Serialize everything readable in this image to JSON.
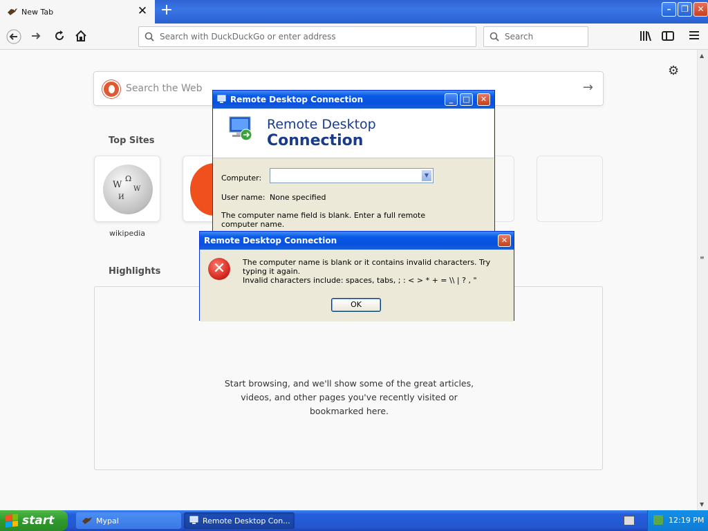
{
  "browser": {
    "tab": {
      "title": "New Tab",
      "icon": "bird-favicon-icon"
    },
    "toolbar": {
      "url_placeholder": "Search with DuckDuckGo or enter address",
      "search_placeholder": "Search"
    }
  },
  "page": {
    "web_search_placeholder": "Search the Web",
    "top_sites_title": "Top Sites",
    "top_sites": [
      {
        "label": "wikipedia",
        "icon": "wikipedia-globe-icon"
      },
      {
        "label": "",
        "icon": "brave-lion-icon"
      }
    ],
    "highlights_title": "Highlights",
    "highlights_empty": "Start browsing, and we'll show some of the great articles, videos, and other pages you've recently visited or bookmarked here.",
    "highlights_empty_lines": [
      "Start browsing, and we'll show some of the great articles,",
      "videos, and other pages you've recently visited or",
      "bookmarked here."
    ]
  },
  "rdc_window": {
    "title": "Remote Desktop Connection",
    "banner_line1": "Remote Desktop",
    "banner_line2": "Connection",
    "computer_label": "Computer:",
    "computer_value": "",
    "username_label": "User name:",
    "username_value": "None specified",
    "hint": "The computer name field is blank. Enter a full remote computer name."
  },
  "error_dialog": {
    "title": "Remote Desktop Connection",
    "message": "The computer name is blank or it contains invalid characters. Try typing it again.",
    "detail": "Invalid characters include: spaces, tabs, ; : < > * + = \\\\ | ? , \"",
    "ok_label": "OK"
  },
  "taskbar": {
    "start_label": "start",
    "tasks": [
      {
        "label": "Mypal",
        "icon": "mypal-icon"
      },
      {
        "label": "Remote Desktop Con...",
        "icon": "remote-desktop-icon"
      }
    ],
    "clock": "12:19 PM"
  },
  "colors": {
    "xp_blue": "#0a59e6",
    "xp_green": "#2f9a2c",
    "dialog_bg": "#ece9d8"
  }
}
